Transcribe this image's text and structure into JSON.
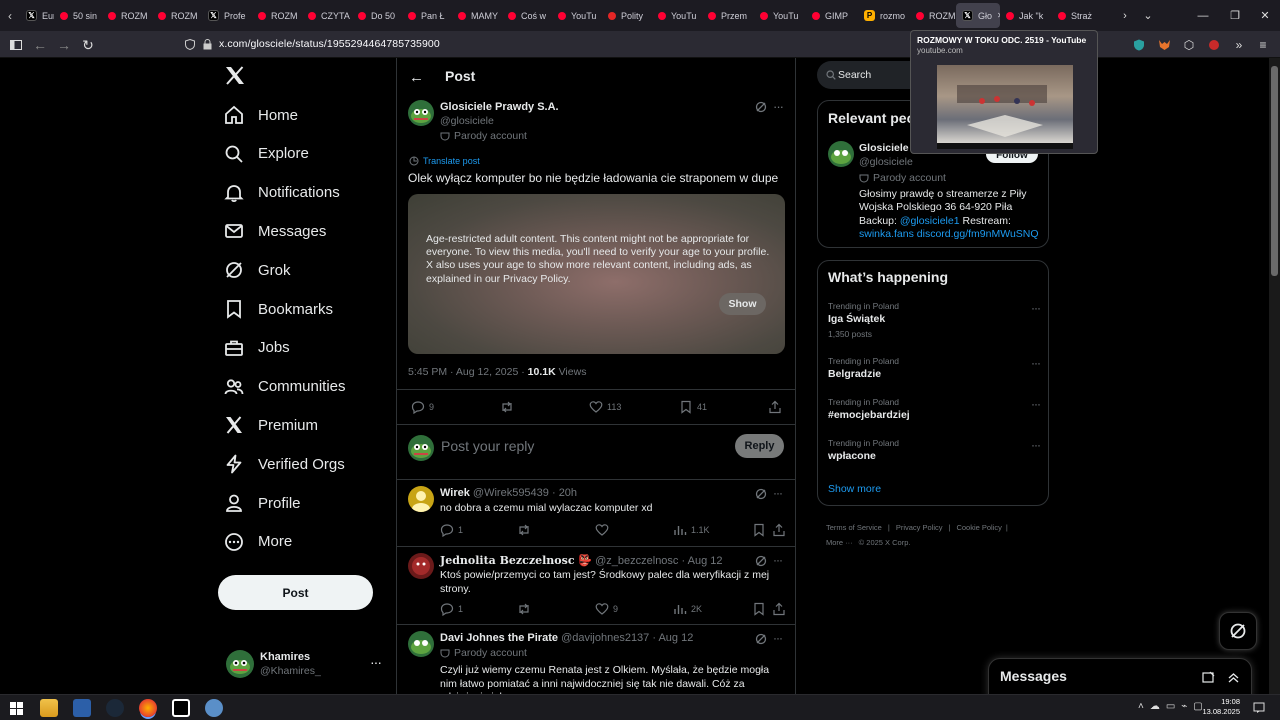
{
  "browser": {
    "tabs": [
      {
        "label": "Europ",
        "fav": "x"
      },
      {
        "label": "50 sin",
        "fav": "yt"
      },
      {
        "label": "ROZM",
        "fav": "yt"
      },
      {
        "label": "ROZM",
        "fav": "yt"
      },
      {
        "label": "Profe",
        "fav": "x"
      },
      {
        "label": "ROZM",
        "fav": "yt"
      },
      {
        "label": "CZYTA",
        "fav": "yt"
      },
      {
        "label": "Do 50",
        "fav": "yt"
      },
      {
        "label": "Pan Ł",
        "fav": "yt"
      },
      {
        "label": "MAMY",
        "fav": "yt"
      },
      {
        "label": "Coś w",
        "fav": "yt"
      },
      {
        "label": "YouTu",
        "fav": "yt"
      },
      {
        "label": "Polity",
        "fav": "pl"
      },
      {
        "label": "YouTu",
        "fav": "yt"
      },
      {
        "label": "Przem",
        "fav": "yt"
      },
      {
        "label": "YouTu",
        "fav": "yt"
      },
      {
        "label": "GIMP",
        "fav": "yt"
      },
      {
        "label": "rozmo",
        "fav": "ps"
      },
      {
        "label": "ROZM",
        "fav": "yt"
      },
      {
        "label": "Gło",
        "fav": "x",
        "active": true
      },
      {
        "label": "Jak \"k",
        "fav": "yt"
      },
      {
        "label": "Straż",
        "fav": "yt"
      }
    ],
    "url": "x.com/glosciele/status/1955294464785735900",
    "tooltip": {
      "title": "ROZMOWY W TOKU ODC. 2519 - YouTube",
      "domain": "youtube.com"
    }
  },
  "sidebar": {
    "items": [
      {
        "label": "Home",
        "icon": "home-icon"
      },
      {
        "label": "Explore",
        "icon": "search-icon"
      },
      {
        "label": "Notifications",
        "icon": "bell-icon"
      },
      {
        "label": "Messages",
        "icon": "mail-icon"
      },
      {
        "label": "Grok",
        "icon": "grok-icon"
      },
      {
        "label": "Bookmarks",
        "icon": "bookmark-icon"
      },
      {
        "label": "Jobs",
        "icon": "briefcase-icon"
      },
      {
        "label": "Communities",
        "icon": "people-icon"
      },
      {
        "label": "Premium",
        "icon": "x-logo-icon"
      },
      {
        "label": "Verified Orgs",
        "icon": "lightning-icon"
      },
      {
        "label": "Profile",
        "icon": "person-icon"
      },
      {
        "label": "More",
        "icon": "more-circle-icon"
      }
    ],
    "post_label": "Post",
    "account": {
      "name": "Khamires",
      "handle": "@Khamires_"
    }
  },
  "main": {
    "header_title": "Post",
    "post": {
      "author": "Glosiciele Prawdy S.A.",
      "handle": "@glosiciele",
      "parody_label": "Parody account",
      "translate_label": "Translate post",
      "text": "Olek wyłącz komputer bo nie będzie ładowania cie straponem w dupe",
      "media_warning": "Age-restricted adult content. This content might not be appropriate for everyone. To view this media, you'll need to verify your age to your profile. X also uses your age to show more relevant content, including ads, as explained in our Privacy Policy.",
      "show_label": "Show",
      "timestamp": "5:45 PM · Aug 12, 2025 · ",
      "views_count": "10.1K",
      "views_label": " Views",
      "replies": "9",
      "likes": "113",
      "bookmarks": "41"
    },
    "reply_box": {
      "placeholder": "Post your reply",
      "button": "Reply"
    },
    "replies": [
      {
        "name": "Wirek",
        "handle": "@Wirek595439",
        "time": "· 20h",
        "text": "no dobra a czemu mial wylaczac komputer xd",
        "replies": "1",
        "retweets": "",
        "likes": "",
        "views": "1.1K"
      },
      {
        "name": "Jednolita Bezczelnosc 👺",
        "handle": "@z_bezczelnosc",
        "time": "· Aug 12",
        "text": "Ktoś powie/przemyci co tam jest? Środkowy palec dla weryfikacji z mej strony.",
        "replies": "1",
        "retweets": "",
        "likes": "9",
        "views": "2K"
      },
      {
        "name": "Davi Johnes the Pirate",
        "handle": "@davijohnes2137",
        "time": "· Aug 12",
        "parody": "Parody account",
        "text": "Czyli już wiemy czemu Renata jest z Olkiem. Myślała, że będzie mogła nim łatwo pomiatać a inni najwidoczniej się tak nie dawali. Cóż za zdziwienie jak"
      }
    ]
  },
  "right": {
    "search_placeholder": "Search",
    "relevant_title": "Relevant people",
    "person": {
      "name": "Glosiciele Prawdy S.A.",
      "handle": "@glosiciele",
      "parody_label": "Parody account",
      "follow_label": "Follow",
      "bio_1": "Głosimy prawdę o streamerze z Piły",
      "bio_2": "Wojska Polskiego 36 64-920 Piła",
      "bio_3": "Backup: ",
      "bio_link": "@glosiciele1",
      "bio_4": " Restream:",
      "bio_links2": "swinka.fans discord.gg/fm9nMWuSNQ"
    },
    "happening_title": "What’s happening",
    "trends": [
      {
        "caption": "Trending in Poland",
        "name": "Iga Świątek",
        "posts": "1,350 posts"
      },
      {
        "caption": "Trending in Poland",
        "name": "Belgradzie",
        "posts": ""
      },
      {
        "caption": "Trending in Poland",
        "name": "#emocjebardziej",
        "posts": ""
      },
      {
        "caption": "Trending in Poland",
        "name": "wpłacone",
        "posts": ""
      }
    ],
    "show_more": "Show more",
    "footer": {
      "terms": "Terms of Service",
      "privacy": "Privacy Policy",
      "cookie": "Cookie Policy",
      "more": "More ···",
      "copyright": "© 2025 X Corp."
    },
    "messages_title": "Messages"
  },
  "taskbar": {
    "time": "19:08",
    "date": "13.08.2025"
  }
}
